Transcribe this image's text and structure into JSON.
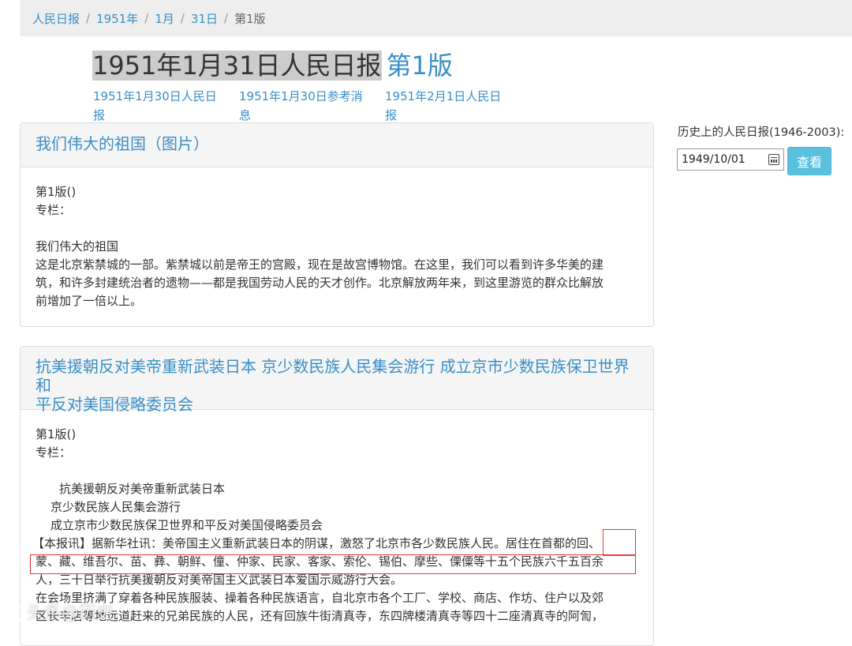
{
  "breadcrumb": {
    "items": [
      "人民日报",
      "1951年",
      "1月",
      "31日"
    ],
    "active": "第1版",
    "sep": "/"
  },
  "title": {
    "main": "1951年1月31日人民日报",
    "page": "第1版"
  },
  "related": [
    {
      "line1": "1951年1月30日人民日",
      "line2": "报"
    },
    {
      "line1": "1951年1月30日参考消",
      "line2": "息"
    },
    {
      "line1": "1951年2月1日人民日",
      "line2": "报"
    }
  ],
  "sidebar": {
    "label": "历史上的人民日报(1946-2003):",
    "date_value": "1949/10/01",
    "button_label": "查看"
  },
  "articles": [
    {
      "title": "我们伟大的祖国（图片）",
      "meta_page": "第1版()",
      "meta_column": "专栏：",
      "lines": [
        "我们伟大的祖国",
        "这是北京紫禁城的一部。紫禁城以前是帝王的宫殿，现在是故宫博物馆。在这里，我们可以看到许多华美的建",
        "筑，和许多封建统治者的遗物——都是我国劳动人民的天才创作。北京解放两年来，到这里游览的群众比解放",
        "前增加了一倍以上。"
      ]
    },
    {
      "title_line1": "抗美援朝反对美帝重新武装日本 京少数民族人民集会游行 成立京市少数民族保卫世界和",
      "title_line2": "平反对美国侵略委员会",
      "meta_page": "第1版()",
      "meta_column": "专栏：",
      "subheads": [
        "抗美援朝反对美帝重新武装日本",
        "京少数民族人民集会游行",
        "成立京市少数民族保卫世界和平反对美国侵略委员会"
      ],
      "lines": [
        "【本报讯】据新华社讯：美帝国主义重新武装日本的阴谋，激怒了北京市各少数民族人民。居住在首都的回、",
        "蒙、藏、维吾尔、苗、彝、朝鲜、僮、仲家、民家、客家、索伦、锡伯、摩些、傈僳等十五个民族六千五百余",
        "人，三十日举行抗美援朝反对美帝国主义武装日本爱国示威游行大会。",
        "在会场里挤满了穿着各种民族服装、操着各种民族语言，自北京市各个工厂、学校、商店、作坊、住户以及郊",
        "区长辛店等地远道赶来的兄弟民族的人民，还有回族牛街清真寺，东四牌楼清真寺等四十二座清真寺的阿訇，"
      ]
    }
  ],
  "watermark": "头条@历史"
}
